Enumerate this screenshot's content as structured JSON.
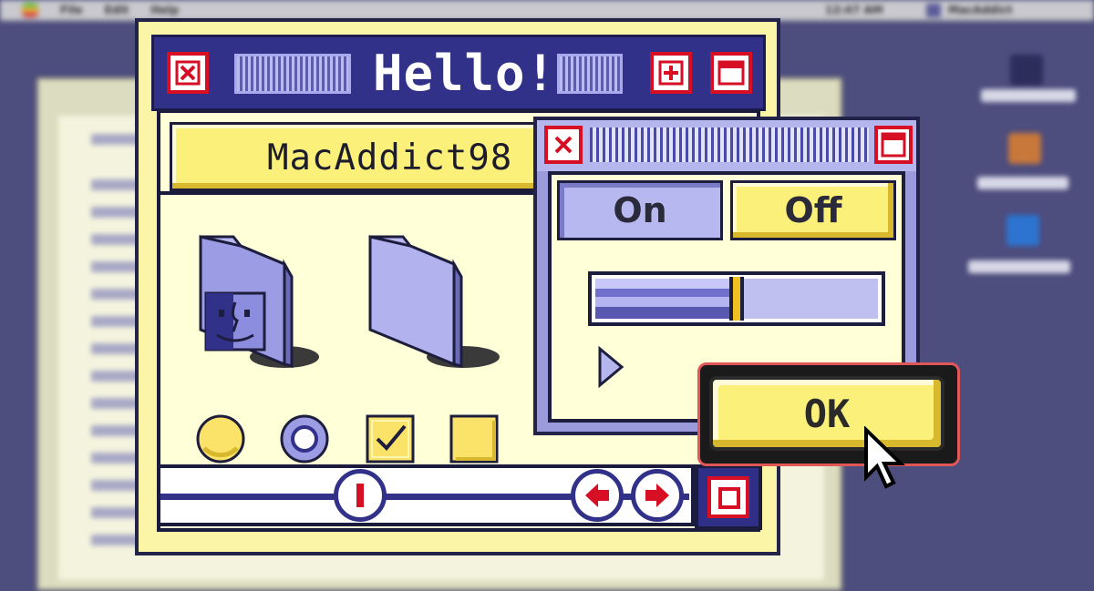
{
  "desktop": {
    "menubar": {
      "items": [
        "File",
        "Edit",
        "Help"
      ],
      "clock": "12:47 AM",
      "app_name": "MacAddict"
    }
  },
  "main_window": {
    "title": "Hello!",
    "name_field_value": "MacAddict98",
    "icons": [
      "finder-folder-icon",
      "folder-icon"
    ],
    "controls": {
      "radio_unselected": false,
      "radio_selected": true,
      "checkbox_checked": true,
      "checkbox_unchecked": false
    },
    "scroll_icons": [
      "scroll-thumb-icon",
      "scroll-left-arrow-icon",
      "scroll-right-arrow-icon"
    ]
  },
  "control_panel": {
    "on_label": "On",
    "off_label": "Off",
    "selected": "On",
    "slider_level": 0.5
  },
  "ok_dialog": {
    "ok_label": "OK"
  },
  "colors": {
    "navy": "#31318a",
    "yellow": "#fbf07a",
    "cream": "#ffffd8",
    "periwinkle": "#9b9bdc",
    "red": "#d60f25"
  }
}
